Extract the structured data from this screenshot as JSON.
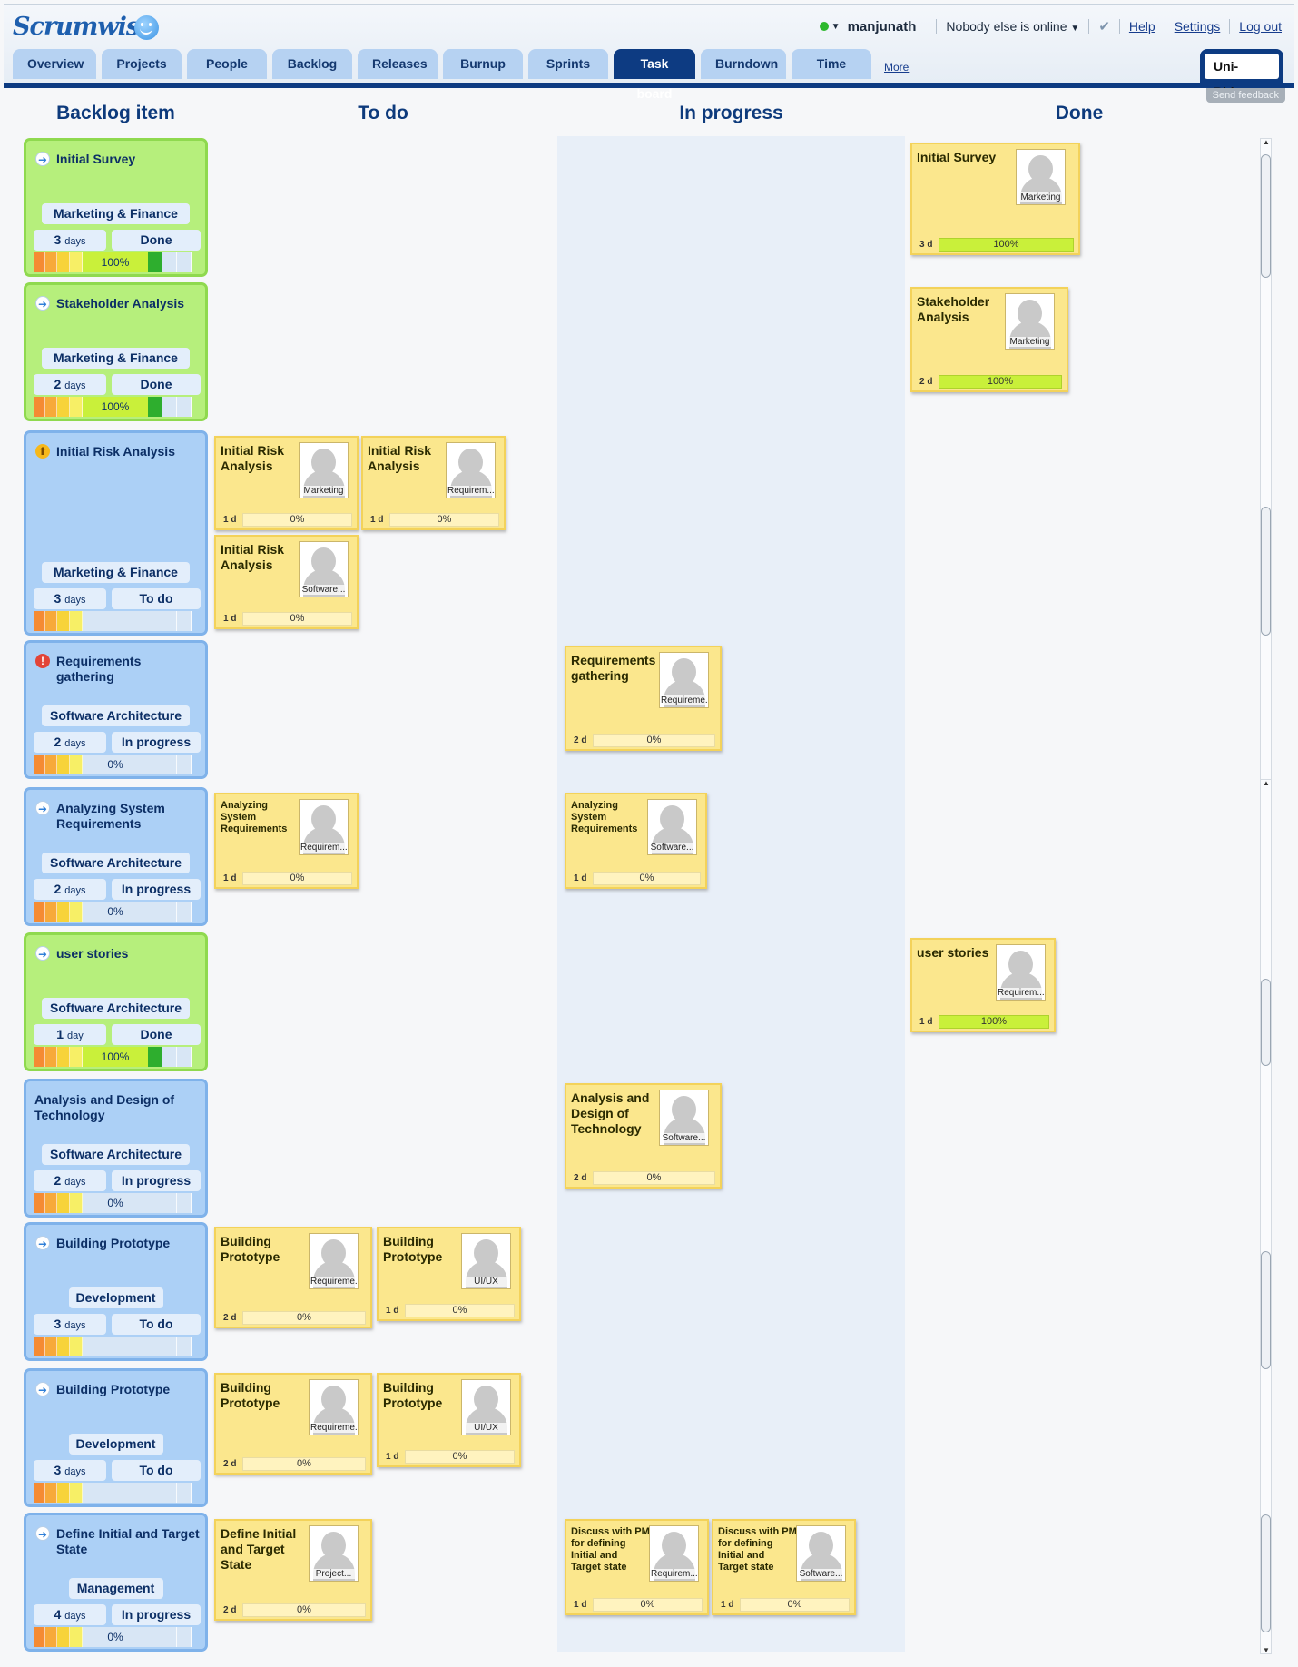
{
  "app": {
    "logo": "Scrumwise",
    "user": "manjunath",
    "online_status": "Nobody else is online",
    "links": {
      "help": "Help",
      "settings": "Settings",
      "logout": "Log out"
    },
    "project": "Uni-Ride",
    "feedback": "Send feedback",
    "more": "More"
  },
  "tabs": [
    "Overview",
    "Projects",
    "People",
    "Backlog",
    "Releases",
    "Burnup",
    "Sprints",
    "Task board",
    "Burndown",
    "Time"
  ],
  "active_tab": "Task board",
  "columns": {
    "backlog": "Backlog item",
    "todo": "To do",
    "inprogress": "In progress",
    "done": "Done"
  },
  "backlog": [
    {
      "title": "Initial Survey",
      "team": "Marketing & Finance",
      "days": "3",
      "unit": "days",
      "status": "Done",
      "progress": "100%",
      "color": "green",
      "icon": "arrow-right-icon"
    },
    {
      "title": "Stakeholder Analysis",
      "team": "Marketing & Finance",
      "days": "2",
      "unit": "days",
      "status": "Done",
      "progress": "100%",
      "color": "green",
      "icon": "arrow-right-icon"
    },
    {
      "title": "Initial Risk Analysis",
      "team": "Marketing & Finance",
      "days": "3",
      "unit": "days",
      "status": "To do",
      "progress": "",
      "color": "blue",
      "icon": "arrow-up-icon"
    },
    {
      "title": "Requirements gathering",
      "team": "Software Architecture",
      "days": "2",
      "unit": "days",
      "status": "In progress",
      "progress": "0%",
      "color": "blue",
      "icon": "warning-icon"
    },
    {
      "title": "Analyzing System Requirements",
      "team": "Software Architecture",
      "days": "2",
      "unit": "days",
      "status": "In progress",
      "progress": "0%",
      "color": "blue",
      "icon": "arrow-right-icon"
    },
    {
      "title": "user stories",
      "team": "Software Architecture",
      "days": "1",
      "unit": "day",
      "status": "Done",
      "progress": "100%",
      "color": "green",
      "icon": "arrow-right-icon"
    },
    {
      "title": "Analysis and Design of Technology",
      "team": "Software Architecture",
      "days": "2",
      "unit": "days",
      "status": "In progress",
      "progress": "0%",
      "color": "blue",
      "icon": ""
    },
    {
      "title": "Building Prototype",
      "team": "Development",
      "days": "3",
      "unit": "days",
      "status": "To do",
      "progress": "",
      "color": "blue",
      "icon": "arrow-right-icon"
    },
    {
      "title": "Building Prototype",
      "team": "Development",
      "days": "3",
      "unit": "days",
      "status": "To do",
      "progress": "",
      "color": "blue",
      "icon": "arrow-right-icon"
    },
    {
      "title": "Define Initial and Target State",
      "team": "Management",
      "days": "4",
      "unit": "days",
      "status": "In progress",
      "progress": "0%",
      "color": "blue",
      "icon": "arrow-right-icon"
    }
  ],
  "tasks": [
    {
      "title": "Initial Survey",
      "role": "Marketing",
      "est": "3 d",
      "pct": "100%",
      "done": true
    },
    {
      "title": "Stakeholder Analysis",
      "role": "Marketing",
      "est": "2 d",
      "pct": "100%",
      "done": true
    },
    {
      "title": "Initial Risk Analysis",
      "role": "Marketing",
      "est": "1 d",
      "pct": "0%"
    },
    {
      "title": "Initial Risk Analysis",
      "role": "Requirem...",
      "est": "1 d",
      "pct": "0%"
    },
    {
      "title": "Initial Risk Analysis",
      "role": "Software...",
      "est": "1 d",
      "pct": "0%"
    },
    {
      "title": "Requirements gathering",
      "role": "Requireme...",
      "est": "2 d",
      "pct": "0%"
    },
    {
      "title": "Analyzing System Requirements",
      "role": "Requirem...",
      "est": "1 d",
      "pct": "0%"
    },
    {
      "title": "Analyzing System Requirements",
      "role": "Software...",
      "est": "1 d",
      "pct": "0%"
    },
    {
      "title": "user stories",
      "role": "Requirem...",
      "est": "1 d",
      "pct": "100%",
      "done": true
    },
    {
      "title": "Analysis and Design of Technology",
      "role": "Software...",
      "est": "2 d",
      "pct": "0%"
    },
    {
      "title": "Building Prototype",
      "role": "Requireme...",
      "est": "2 d",
      "pct": "0%"
    },
    {
      "title": "Building Prototype",
      "role": "UI/UX",
      "est": "1 d",
      "pct": "0%"
    },
    {
      "title": "Building Prototype",
      "role": "Requireme...",
      "est": "2 d",
      "pct": "0%"
    },
    {
      "title": "Building Prototype",
      "role": "UI/UX",
      "est": "1 d",
      "pct": "0%"
    },
    {
      "title": "Define Initial and Target State",
      "role": "Project...",
      "est": "2 d",
      "pct": "0%"
    },
    {
      "title": "Discuss with PM for defining Initial and Target state",
      "role": "Requirem...",
      "est": "1 d",
      "pct": "0%"
    },
    {
      "title": "Discuss with PM for defining Initial and Target state",
      "role": "Software...",
      "est": "1 d",
      "pct": "0%"
    }
  ]
}
